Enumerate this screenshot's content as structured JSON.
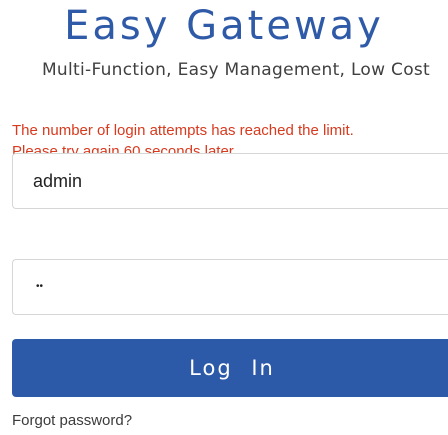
{
  "header": {
    "title": "Easy Gateway",
    "subtitle": "Multi-Function, Easy Management, Low Cost"
  },
  "error": {
    "line1": "The number of login attempts has reached the limit.",
    "line2": "Please try again 60 seconds later."
  },
  "form": {
    "username_value": "admin",
    "password_mask": "••",
    "login_label": "Log In",
    "forgot_password_label": "Forgot password?"
  },
  "colors": {
    "brand": "#2e5aa8",
    "button": "#2d5aa8",
    "error": "#d83a1e"
  }
}
